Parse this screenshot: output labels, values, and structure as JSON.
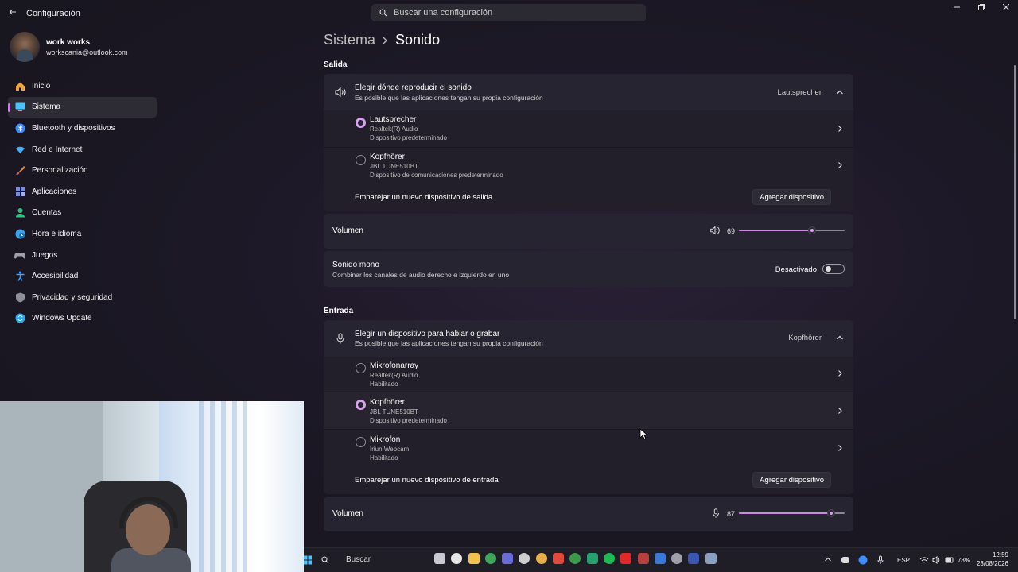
{
  "window": {
    "title": "Configuración",
    "search_placeholder": "Buscar una configuración"
  },
  "profile": {
    "name": "work works",
    "email": "workscania@outlook.com"
  },
  "nav": [
    {
      "label": "Inicio",
      "icon": "home-icon",
      "color": "#f0a23c"
    },
    {
      "label": "Sistema",
      "icon": "monitor-icon",
      "color": "#4cc2ff",
      "active": true
    },
    {
      "label": "Bluetooth y dispositivos",
      "icon": "bluetooth-icon",
      "color": "#3f8cff"
    },
    {
      "label": "Red e Internet",
      "icon": "wifi-icon",
      "color": "#3fb0ff"
    },
    {
      "label": "Personalización",
      "icon": "brush-icon",
      "color": "#e8873a"
    },
    {
      "label": "Aplicaciones",
      "icon": "apps-icon",
      "color": "#7c8bd6"
    },
    {
      "label": "Cuentas",
      "icon": "person-icon",
      "color": "#2ec27e"
    },
    {
      "label": "Hora e idioma",
      "icon": "globe-clock-icon",
      "color": "#3aa0e8"
    },
    {
      "label": "Juegos",
      "icon": "gamepad-icon",
      "color": "#a0a0a8"
    },
    {
      "label": "Accesibilidad",
      "icon": "accessibility-icon",
      "color": "#3fa0ff"
    },
    {
      "label": "Privacidad y seguridad",
      "icon": "shield-icon",
      "color": "#8f8f99"
    },
    {
      "label": "Windows Update",
      "icon": "update-icon",
      "color": "#2fa6e8"
    }
  ],
  "breadcrumb": {
    "parent": "Sistema",
    "current": "Sonido"
  },
  "output": {
    "section_label": "Salida",
    "choose_title": "Elegir dónde reproducir el sonido",
    "choose_desc": "Es posible que las aplicaciones tengan su propia configuración",
    "selected": "Lautsprecher",
    "devices": [
      {
        "name": "Lautsprecher",
        "line1": "Realtek(R) Audio",
        "line2": "Dispositivo predeterminado",
        "selected": true
      },
      {
        "name": "Kopfhörer",
        "line1": "JBL TUNE510BT",
        "line2": "Dispositivo de comunicaciones predeterminado",
        "selected": false
      }
    ],
    "pair_label": "Emparejar un nuevo dispositivo de salida",
    "add_button": "Agregar dispositivo",
    "volume_label": "Volumen",
    "volume": 69,
    "mono_title": "Sonido mono",
    "mono_desc": "Combinar los canales de audio derecho e izquierdo en uno",
    "mono_state": "Desactivado"
  },
  "input": {
    "section_label": "Entrada",
    "choose_title": "Elegir un dispositivo para hablar o grabar",
    "choose_desc": "Es posible que las aplicaciones tengan su propia configuración",
    "selected": "Kopfhörer",
    "devices": [
      {
        "name": "Mikrofonarray",
        "line1": "Realtek(R) Audio",
        "line2": "Habilitado",
        "selected": false
      },
      {
        "name": "Kopfhörer",
        "line1": "JBL TUNE510BT",
        "line2": "Dispositivo predeterminado",
        "selected": true
      },
      {
        "name": "Mikrofon",
        "line1": "Iriun Webcam",
        "line2": "Habilitado",
        "selected": false
      }
    ],
    "pair_label": "Emparejar un nuevo dispositivo de entrada",
    "add_button": "Agregar dispositivo",
    "volume_label": "Volumen",
    "volume": 87
  },
  "taskbar": {
    "search_label": "Buscar",
    "language": "ESP",
    "battery": "78%",
    "time": "12:59",
    "date": "23/08/2026"
  },
  "colors": {
    "accent": "#d9a0ee",
    "card": "#262430"
  }
}
